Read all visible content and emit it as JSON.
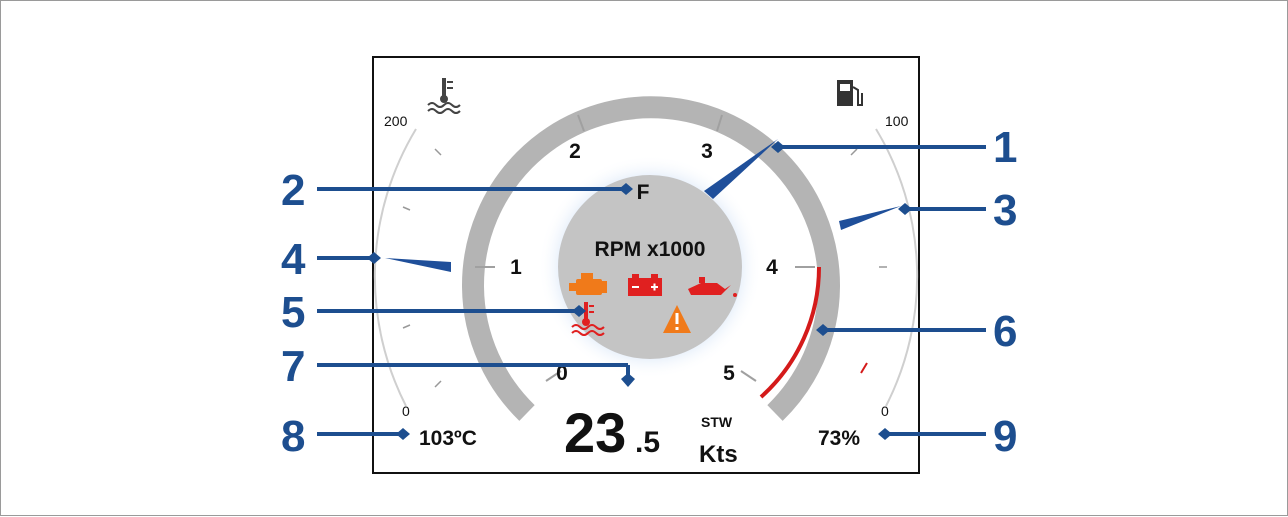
{
  "gauge": {
    "rpm_label": "RPM x1000",
    "rpm_ticks": [
      "0",
      "1",
      "2",
      "3",
      "4",
      "5"
    ],
    "rpm_value": 3.5,
    "fuel_range": "F",
    "speed": {
      "integer": "23",
      "decimal": ".5",
      "source": "STW",
      "unit": "Kts"
    },
    "temperature": {
      "scale_max": "200",
      "scale_min": "0",
      "readout": "103ºC"
    },
    "fuel": {
      "scale_max": "100",
      "scale_min": "0",
      "readout": "73%"
    },
    "warning_icons": [
      "engine-icon",
      "battery-icon",
      "oil-pressure-icon",
      "coolant-temperature-icon",
      "warning-triangle-icon"
    ],
    "gauge_icons": [
      "coolant-temperature-icon",
      "fuel-pump-icon"
    ]
  },
  "callouts": [
    "1",
    "2",
    "3",
    "4",
    "5",
    "6",
    "7",
    "8",
    "9"
  ],
  "colors": {
    "callout_blue": "#1d4e8f",
    "needle_blue": "#1f4f9a",
    "redline": "#d41a1a",
    "warning_orange": "#f07a1a",
    "warning_red": "#e02020",
    "dial_grey": "#c4c4c4",
    "arc_grey": "#b4b4b4"
  }
}
